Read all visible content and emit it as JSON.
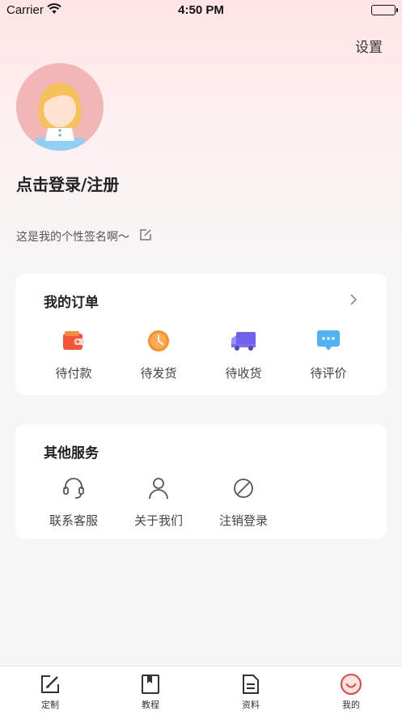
{
  "status_bar": {
    "carrier": "Carrier",
    "time": "4:50 PM"
  },
  "header": {
    "settings_label": "设置"
  },
  "profile": {
    "login_label": "点击登录/注册",
    "signature": "这是我的个性签名啊～"
  },
  "orders": {
    "title": "我的订单",
    "items": [
      {
        "label": "待付款",
        "icon": "wallet-icon"
      },
      {
        "label": "待发货",
        "icon": "clock-icon"
      },
      {
        "label": "待收货",
        "icon": "truck-icon"
      },
      {
        "label": "待评价",
        "icon": "comment-icon"
      }
    ]
  },
  "services": {
    "title": "其他服务",
    "items": [
      {
        "label": "联系客服",
        "icon": "headset-icon"
      },
      {
        "label": "关于我们",
        "icon": "person-icon"
      },
      {
        "label": "注销登录",
        "icon": "ban-icon"
      }
    ]
  },
  "tabbar": {
    "tabs": [
      {
        "label": "定制",
        "icon": "edit-square-icon"
      },
      {
        "label": "教程",
        "icon": "bookmark-book-icon"
      },
      {
        "label": "资料",
        "icon": "document-icon"
      },
      {
        "label": "我的",
        "icon": "smile-icon"
      }
    ],
    "active_index": 3,
    "active_color": "#e8453c"
  },
  "colors": {
    "avatar_bg": "#f2b6b7",
    "wallet": "#f2553a",
    "clock": "#f7902b",
    "truck": "#7b6ff0",
    "comment": "#4fb3f5"
  }
}
